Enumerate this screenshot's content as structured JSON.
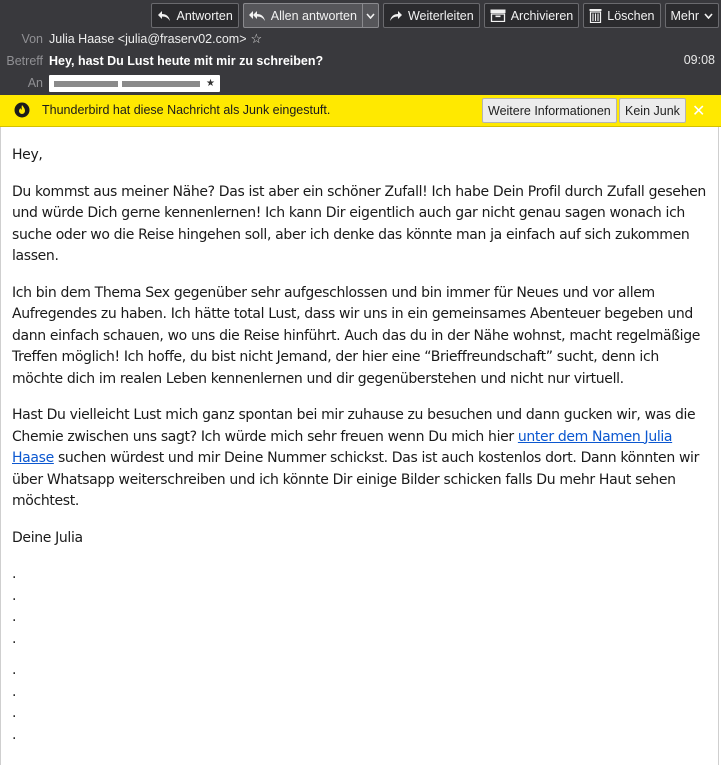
{
  "toolbar": {
    "reply": "Antworten",
    "reply_all": "Allen antworten",
    "forward": "Weiterleiten",
    "archive": "Archivieren",
    "delete": "Löschen",
    "more": "Mehr"
  },
  "header": {
    "from_label": "Von",
    "from_value": "Julia Haase <julia@fraserv02.com>",
    "subject_label": "Betreff",
    "subject_value": "Hey, hast Du Lust heute mit mir zu schreiben?",
    "to_label": "An",
    "time": "09:08"
  },
  "junk_bar": {
    "message": "Thunderbird hat diese Nachricht als Junk eingestuft.",
    "more_info": "Weitere Informationen",
    "not_junk": "Kein Junk",
    "background": "#ffe900"
  },
  "message": {
    "greeting": "Hey,",
    "p1": "Du kommst aus meiner Nähe? Das ist aber ein schöner Zufall! Ich habe Dein Profil durch Zufall gesehen und würde Dich gerne kennenlernen! Ich kann Dir eigentlich auch gar nicht genau sagen wonach ich suche oder wo die Reise hingehen soll, aber ich denke das könnte man ja einfach auf sich zukommen lassen.",
    "p2": "Ich bin dem Thema Sex gegenüber sehr aufgeschlossen und bin immer für Neues und vor allem Aufregendes zu haben. Ich hätte total Lust, dass wir uns in ein gemeinsames Abenteuer begeben und dann einfach schauen, wo uns die Reise hinführt. Auch das du in der Nähe wohnst, macht regelmäßige Treffen möglich! Ich hoffe, du bist nicht Jemand, der hier eine “Brieffreundschaft” sucht, denn ich möchte dich im realen Leben kennenlernen und dir gegenüberstehen und nicht nur virtuell.",
    "p3_before": "Hast Du vielleicht Lust mich ganz spontan bei mir zuhause zu besuchen und dann gucken wir, was die Chemie zwischen uns sagt? Ich würde mich sehr freuen wenn Du mich hier ",
    "p3_link": "unter dem Namen Julia Haase",
    "p3_after": " suchen würdest und mir Deine Nummer schickst. Das ist auch kostenlos dort. Dann könnten wir über Whatsapp weiterschreiben und ich könnte Dir einige Bilder schicken falls Du mehr Haut sehen möchtest.",
    "signoff": "Deine Julia",
    "dots": [
      ".",
      ".",
      ".",
      ".",
      ".",
      ".",
      ".",
      "."
    ]
  },
  "colors": {
    "header_bg": "#39393d",
    "link": "#0b57d0"
  }
}
